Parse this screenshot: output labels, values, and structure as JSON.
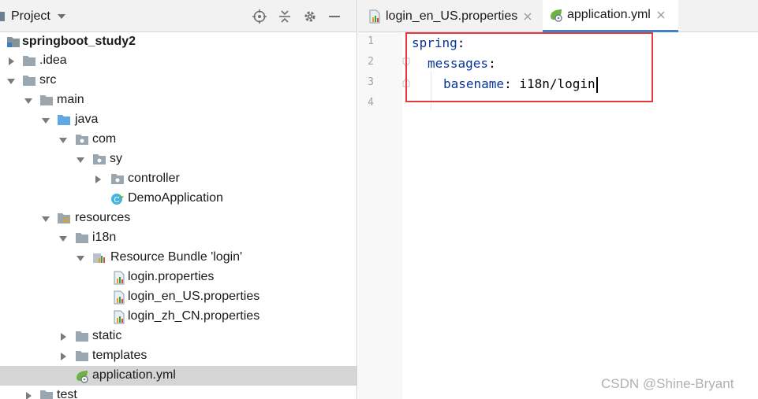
{
  "project_panel": {
    "title": "Project",
    "tree": [
      {
        "label": "springboot_study2",
        "icon": "module-folder-icon",
        "arrow": "down",
        "bold": true
      },
      {
        "label": ".idea",
        "icon": "folder-icon",
        "arrow": "right"
      },
      {
        "label": "src",
        "icon": "folder-icon",
        "arrow": "down"
      },
      {
        "label": "main",
        "icon": "folder-icon",
        "arrow": "down"
      },
      {
        "label": "java",
        "icon": "source-folder-icon",
        "arrow": "down"
      },
      {
        "label": "com",
        "icon": "package-icon",
        "arrow": "down"
      },
      {
        "label": "sy",
        "icon": "package-icon",
        "arrow": "down"
      },
      {
        "label": "controller",
        "icon": "package-icon",
        "arrow": "right"
      },
      {
        "label": "DemoApplication",
        "icon": "spring-class-icon",
        "arrow": "none"
      },
      {
        "label": "resources",
        "icon": "resources-folder-icon",
        "arrow": "down"
      },
      {
        "label": "i18n",
        "icon": "folder-icon",
        "arrow": "down"
      },
      {
        "label": "Resource Bundle 'login'",
        "icon": "resource-bundle-icon",
        "arrow": "down"
      },
      {
        "label": "login.properties",
        "icon": "properties-file-icon",
        "arrow": "none"
      },
      {
        "label": "login_en_US.properties",
        "icon": "properties-file-icon",
        "arrow": "none"
      },
      {
        "label": "login_zh_CN.properties",
        "icon": "properties-file-icon",
        "arrow": "none"
      },
      {
        "label": "static",
        "icon": "folder-icon",
        "arrow": "right"
      },
      {
        "label": "templates",
        "icon": "folder-icon",
        "arrow": "right"
      },
      {
        "label": "application.yml",
        "icon": "yaml-file-icon",
        "arrow": "none",
        "selected": true
      },
      {
        "label": "test",
        "icon": "folder-icon",
        "arrow": "right"
      }
    ]
  },
  "editor": {
    "tabs": [
      {
        "label": "login_en_US.properties",
        "icon": "properties-file-icon",
        "active": false
      },
      {
        "label": "application.yml",
        "icon": "yaml-file-icon",
        "active": true
      }
    ],
    "line_numbers": [
      "1",
      "2",
      "3",
      "4"
    ],
    "code": {
      "line1_key": "spring",
      "line2_key": "messages",
      "line3_key": "basename",
      "line3_value": "i18n/login"
    }
  },
  "watermark": "CSDN @Shine-Bryant",
  "colors": {
    "yaml_key": "#0a3598",
    "highlight_box": "#e5393d",
    "active_tab_underline": "#4083c9",
    "selection": "#d5d5d5"
  }
}
